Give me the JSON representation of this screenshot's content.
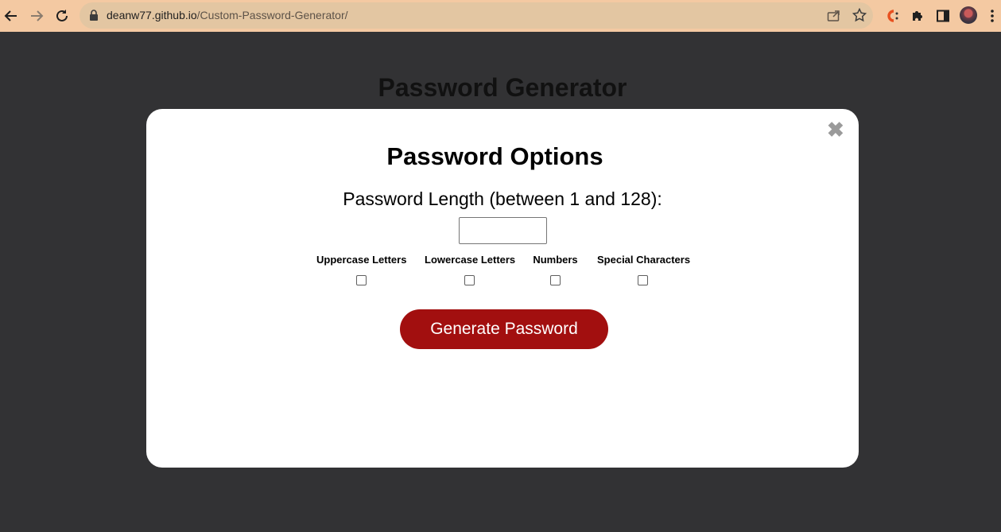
{
  "browser": {
    "url_host": "deanw77.github.io",
    "url_path": "/Custom-Password-Generator/"
  },
  "page": {
    "title": "Password Generator"
  },
  "modal": {
    "title": "Password Options",
    "close_glyph": "✖",
    "length_label": "Password Length (between 1 and 128):",
    "length_value": "",
    "options": [
      {
        "label": "Uppercase Letters",
        "checked": false
      },
      {
        "label": "Lowercase Letters",
        "checked": false
      },
      {
        "label": "Numbers",
        "checked": false
      },
      {
        "label": "Special Characters",
        "checked": false
      }
    ],
    "generate_label": "Generate Password"
  },
  "colors": {
    "page_background": "#323234",
    "chrome_background": "#f4c9a2",
    "button_accent": "#a20f0f"
  }
}
